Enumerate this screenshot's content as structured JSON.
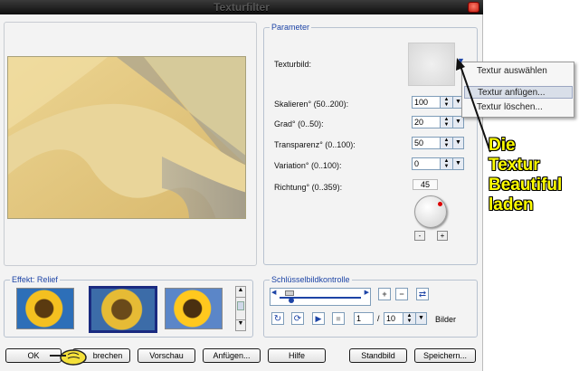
{
  "window": {
    "title": "Texturfilter"
  },
  "parameter": {
    "group_title": "Parameter",
    "texture_label": "Texturbild:",
    "rows": [
      {
        "label": "Skalieren° (50..200):",
        "value": "100"
      },
      {
        "label": "Grad° (0..50):",
        "value": "20"
      },
      {
        "label": "Transparenz° (0..100):",
        "value": "50"
      },
      {
        "label": "Variation° (0..100):",
        "value": "0"
      }
    ],
    "direction_label": "Richtung° (0..359):",
    "direction_value": "45"
  },
  "context_menu": {
    "items": [
      "Textur auswählen",
      "Textur anfügen...",
      "Textur löschen..."
    ],
    "highlighted_index": 1
  },
  "effect": {
    "group_title": "Effekt: Relief"
  },
  "keyframe": {
    "group_title": "Schlüsselbildkontrolle",
    "frame_value": "1",
    "frame_sep": "/",
    "total_frames": "10",
    "frames_label": "Bilder"
  },
  "buttons": {
    "ok": "OK",
    "cancel": "brechen",
    "preview": "Vorschau",
    "append": "Anfügen...",
    "help": "Hilfe",
    "default": "Standbild",
    "save": "Speichern..."
  },
  "annotation": {
    "line1": "Die",
    "line2": "Textur",
    "line3": "Beautiful",
    "line4": "laden"
  },
  "colors": {
    "accent": "#1d44a6",
    "annotation": "#ffff00",
    "titlebar": "#1a1a1a"
  }
}
